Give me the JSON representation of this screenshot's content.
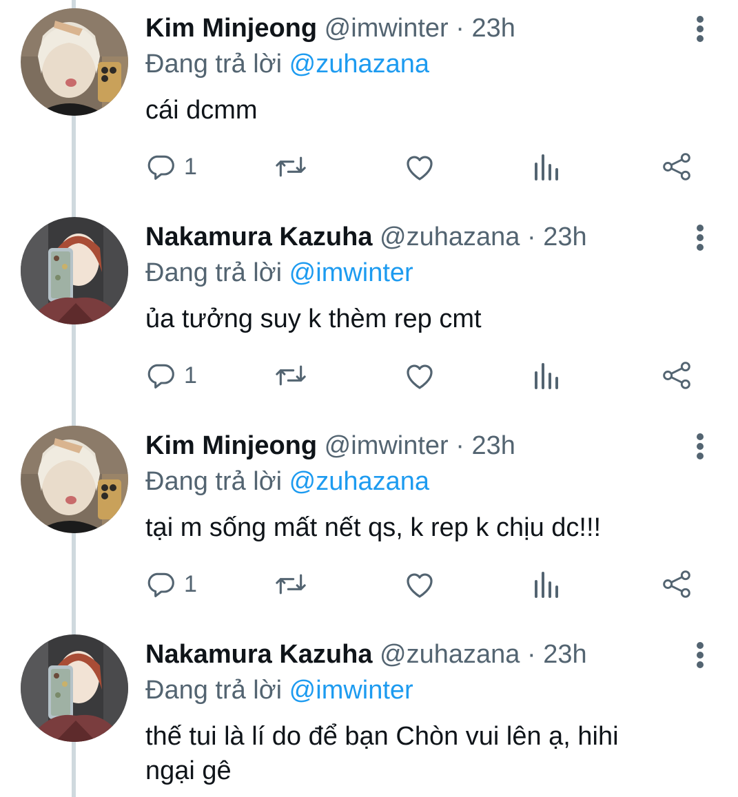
{
  "thread": {
    "tweets": [
      {
        "author_name": "Kim Minjeong",
        "author_handle": "@imwinter",
        "separator": "·",
        "time": "23h",
        "replying_prefix": "Đang trả lời",
        "replying_to": "@zuhazana",
        "text": "cái dcmm",
        "reply_count": "1",
        "avatar": "avatar-kim-minjeong"
      },
      {
        "author_name": "Nakamura Kazuha",
        "author_handle": "@zuhazana",
        "separator": "·",
        "time": "23h",
        "replying_prefix": "Đang trả lời",
        "replying_to": "@imwinter",
        "text": "ủa tưởng suy k thèm rep cmt",
        "reply_count": "1",
        "avatar": "avatar-nakamura-kazuha"
      },
      {
        "author_name": "Kim Minjeong",
        "author_handle": "@imwinter",
        "separator": "·",
        "time": "23h",
        "replying_prefix": "Đang trả lời",
        "replying_to": "@zuhazana",
        "text": "tại m sống mất nết qs, k rep k chịu dc!!!",
        "reply_count": "1",
        "avatar": "avatar-kim-minjeong"
      },
      {
        "author_name": "Nakamura Kazuha",
        "author_handle": "@zuhazana",
        "separator": "·",
        "time": "23h",
        "replying_prefix": "Đang trả lời",
        "replying_to": "@imwinter",
        "text": "thế tui là lí do để bạn Chòn vui lên ạ, hihi ngại gê",
        "avatar": "avatar-nakamura-kazuha"
      }
    ]
  },
  "icons": {
    "reply": "reply-icon",
    "retweet": "retweet-icon",
    "like": "heart-icon",
    "views": "views-icon",
    "share": "share-icon",
    "more": "more-vertical-icon"
  },
  "colors": {
    "text_primary": "#0f1419",
    "text_secondary": "#536471",
    "link": "#1d9bf0",
    "thread_line": "#cfd9de"
  }
}
